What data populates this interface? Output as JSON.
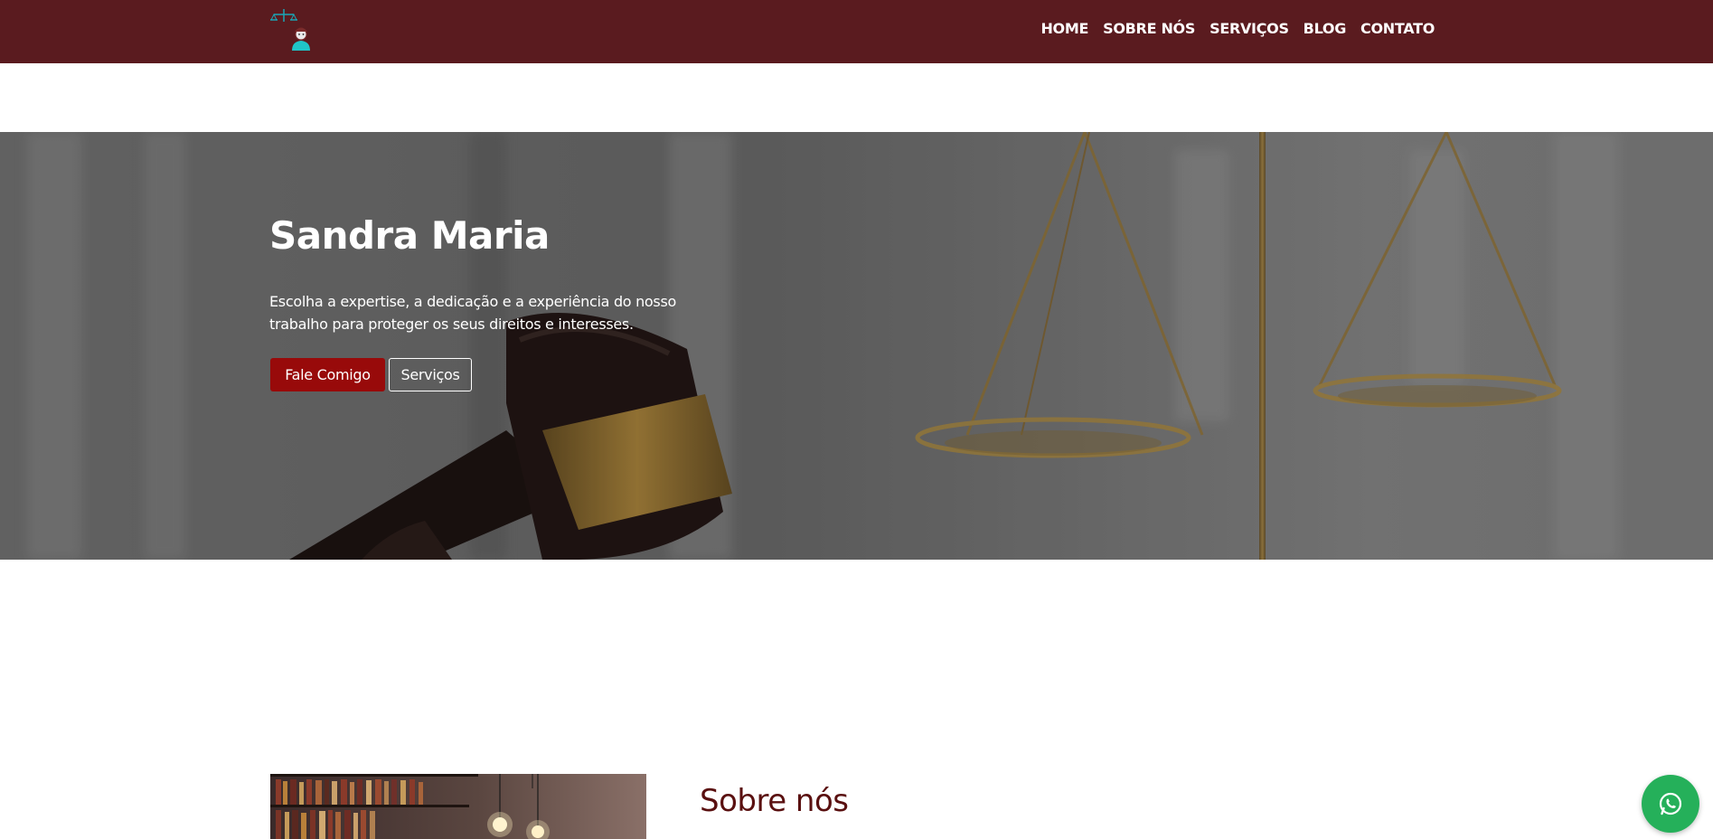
{
  "nav": {
    "items": [
      {
        "label": "HOME"
      },
      {
        "label": "SOBRE NÓS"
      },
      {
        "label": "SERVIÇOS"
      },
      {
        "label": "BLOG"
      },
      {
        "label": "CONTATO"
      }
    ]
  },
  "hero": {
    "title": "Sandra Maria",
    "text": "Escolha a expertise, a dedicação e a experiência do nosso trabalho para proteger os seus direitos e interesses.",
    "primary_button": "Fale Comigo",
    "secondary_button": "Serviços"
  },
  "about": {
    "title": "Sobre nós"
  },
  "icons": {
    "logo": "scales-lawyer-logo-icon",
    "whatsapp": "whatsapp-icon"
  },
  "colors": {
    "header_bg": "#5a1b1f",
    "primary_button": "#980a0a",
    "about_title": "#5a1010",
    "whatsapp": "#25b05a"
  }
}
